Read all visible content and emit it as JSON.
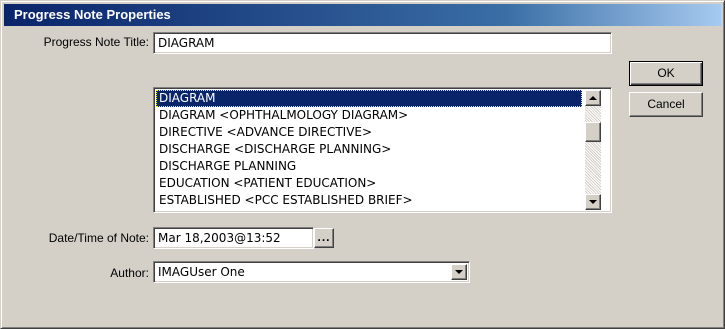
{
  "window": {
    "title": "Progress Note Properties"
  },
  "labels": {
    "title": "Progress Note Title:",
    "datetime": "Date/Time of Note:",
    "author": "Author:"
  },
  "fields": {
    "title_value": "DIAGRAM",
    "datetime_value": "Mar 18,2003@13:52",
    "datetime_button": "...",
    "author_value": "IMAGUser One"
  },
  "list": {
    "items": [
      {
        "label": "DIAGRAM",
        "selected": true
      },
      {
        "label": "DIAGRAM  <OPHTHALMOLOGY DIAGRAM>",
        "selected": false
      },
      {
        "label": "DIRECTIVE  <ADVANCE DIRECTIVE>",
        "selected": false
      },
      {
        "label": "DISCHARGE  <DISCHARGE PLANNING>",
        "selected": false
      },
      {
        "label": "DISCHARGE PLANNING",
        "selected": false
      },
      {
        "label": "EDUCATION  <PATIENT EDUCATION>",
        "selected": false
      },
      {
        "label": "ESTABLISHED  <PCC ESTABLISHED BRIEF>",
        "selected": false
      }
    ]
  },
  "buttons": {
    "ok": "OK",
    "cancel": "Cancel"
  },
  "icons": {
    "scroll_up": "arrow-up-icon",
    "scroll_down": "arrow-down-icon",
    "dropdown": "chevron-down-icon"
  },
  "colors": {
    "titlebar_start": "#0a246a",
    "titlebar_end": "#a6caf0",
    "selection": "#0a246a",
    "face": "#d4d0c8"
  }
}
